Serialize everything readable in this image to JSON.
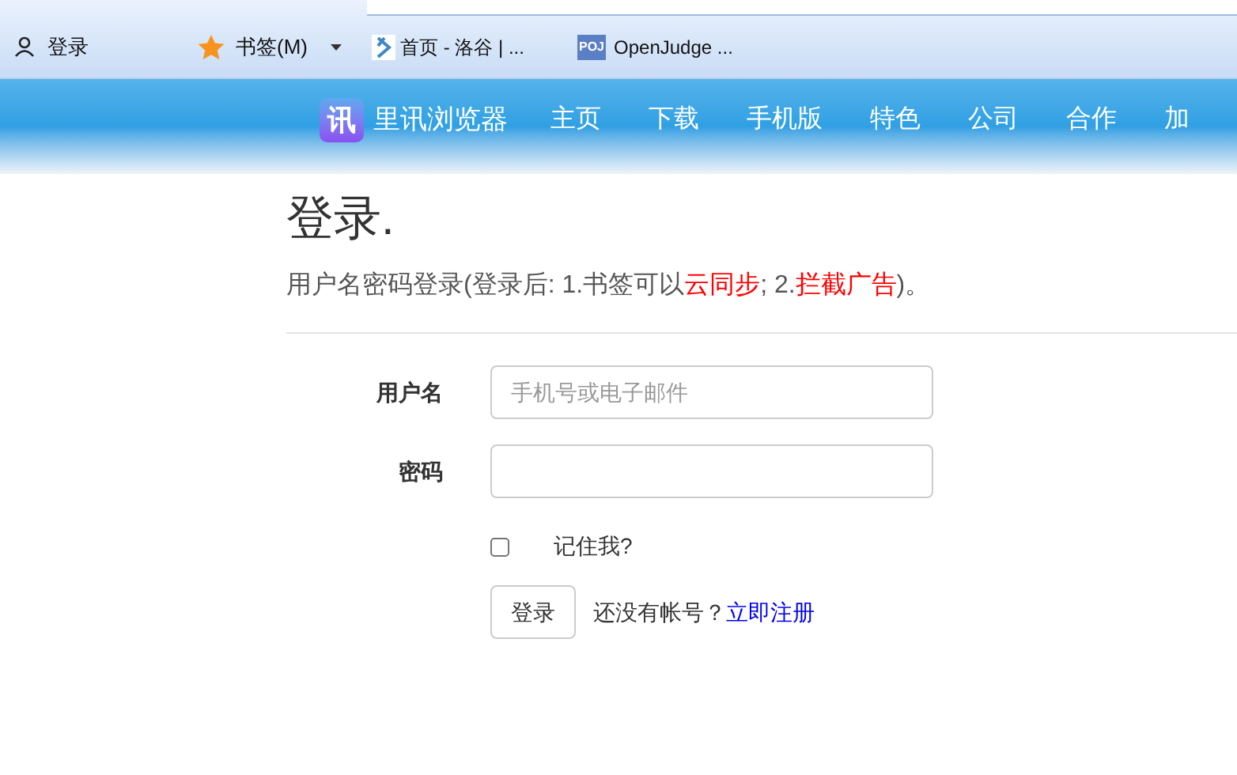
{
  "bookmarks_bar": {
    "login": "登录",
    "bookmarks": "书签(M)",
    "tabs": [
      {
        "kind": "luogu",
        "label": "首页 - 洛谷 | ..."
      },
      {
        "kind": "poj",
        "icon_text": "POJ",
        "label": "OpenJudge ..."
      }
    ]
  },
  "nav": {
    "brand": "里讯浏览器",
    "logo_text": "讯",
    "items": [
      "主页",
      "下载",
      "手机版",
      "特色",
      "公司",
      "合作",
      "加"
    ]
  },
  "page": {
    "title": "登录.",
    "subtitle": [
      {
        "text": "用户名密码登录(登录后: 1.书签可以",
        "highlight": false
      },
      {
        "text": "云同步",
        "highlight": true
      },
      {
        "text": "; 2.",
        "highlight": false
      },
      {
        "text": "拦截广告",
        "highlight": true
      },
      {
        "text": ")。",
        "highlight": false
      }
    ]
  },
  "form": {
    "username_label": "用户名",
    "username_placeholder": "手机号或电子邮件",
    "password_label": "密码",
    "remember": {
      "label": "记住我?",
      "checked": false
    },
    "submit": "登录",
    "no_account": "还没有帐号？",
    "register": "立即注册"
  }
}
